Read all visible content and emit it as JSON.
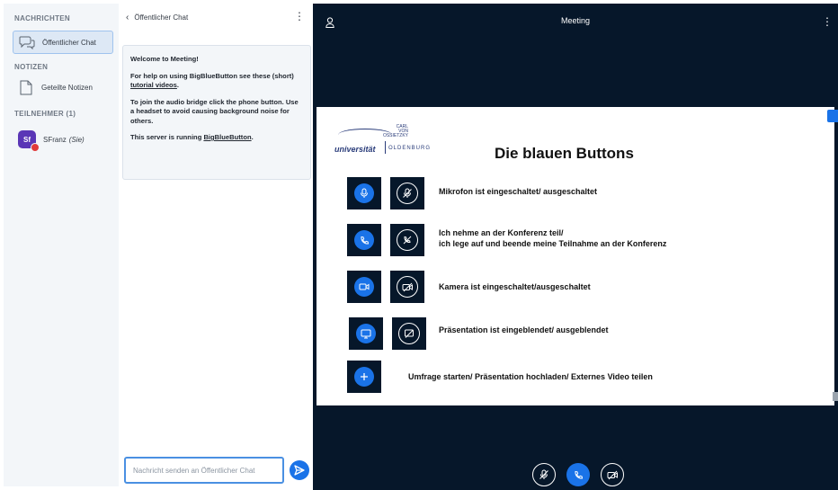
{
  "sidebar": {
    "messages_heading": "NACHRICHTEN",
    "public_chat_label": "Öffentlicher Chat",
    "notes_heading": "NOTIZEN",
    "shared_notes_label": "Geteilte Notizen",
    "participants_heading": "TEILNEHMER (1)",
    "user": {
      "initials": "Sf",
      "name": "SFranz",
      "role": "(Sie)"
    }
  },
  "chat": {
    "header_title": "Öffentlicher Chat",
    "welcome_title": "Welcome to Meeting!",
    "welcome_help_prefix": "For help on using BigBlueButton see these (short) ",
    "welcome_help_link": "tutorial videos",
    "welcome_help_suffix": ".",
    "welcome_audio": "To join the audio bridge click the phone button. Use a headset to avoid causing background noise for others.",
    "welcome_server_prefix": "This server is running ",
    "welcome_server_link": "BigBlueButton",
    "welcome_server_suffix": ".",
    "input_placeholder": "Nachricht senden an Öffentlicher Chat"
  },
  "meeting": {
    "title": "Meeting",
    "slide": {
      "logo_top": "CARL\nVON\nOSSIETZKY",
      "logo_university": "universität",
      "logo_city": "OLDENBURG",
      "title": "Die blauen Buttons",
      "rows": [
        {
          "text": "Mikrofon ist eingeschaltet/ ausgeschaltet"
        },
        {
          "text": "Ich nehme an der Konferenz teil/",
          "text2": "ich lege auf und beende meine Teilnahme an der Konferenz"
        },
        {
          "text": "Kamera ist eingeschaltet/ausgeschaltet"
        },
        {
          "text": "Präsentation ist eingeblendet/  ausgeblendet"
        },
        {
          "text": "Umfrage starten/ Präsentation hochladen/ Externes Video teilen"
        }
      ]
    }
  },
  "colors": {
    "accent": "#1a73e8",
    "meeting_bg": "#06172a",
    "sidebar_bg": "#f3f6f9",
    "avatar": "#5a36b6",
    "status_dot": "#e03a3a"
  },
  "icons": {
    "back": "chevron-left-icon",
    "public_chat": "chat-bubbles-icon",
    "shared_notes": "document-icon",
    "send": "send-arrow-icon",
    "user": "person-icon",
    "mic_on": "microphone-icon",
    "mic_off": "microphone-off-icon",
    "phone": "phone-icon",
    "phone_off": "phone-hangup-icon",
    "cam_on": "camera-icon",
    "cam_off": "camera-off-icon",
    "screen_on": "screen-share-icon",
    "screen_off": "screen-share-off-icon",
    "plus": "plus-icon"
  }
}
